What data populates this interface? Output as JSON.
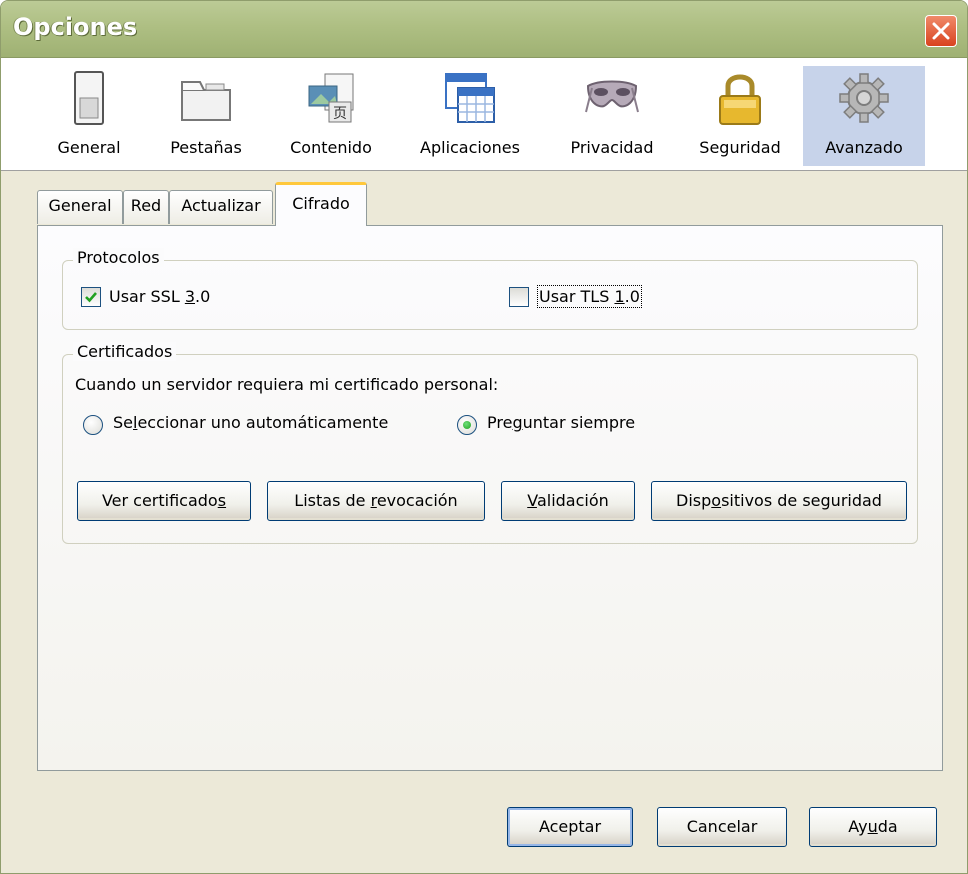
{
  "window": {
    "title": "Opciones"
  },
  "categories": [
    {
      "label": "General"
    },
    {
      "label": "Pestañas"
    },
    {
      "label": "Contenido"
    },
    {
      "label": "Aplicaciones"
    },
    {
      "label": "Privacidad"
    },
    {
      "label": "Seguridad"
    },
    {
      "label": "Avanzado",
      "selected": true
    }
  ],
  "tabs": [
    {
      "label": "General"
    },
    {
      "label": "Red"
    },
    {
      "label": "Actualizar"
    },
    {
      "label": "Cifrado",
      "active": true
    }
  ],
  "protocols": {
    "legend": "Protocolos",
    "ssl": {
      "label_pre": "Usar SSL ",
      "label_key": "3",
      "label_post": ".0",
      "checked": true
    },
    "tls": {
      "label_pre": "Usar TLS ",
      "label_key": "1",
      "label_post": ".0",
      "checked": false
    }
  },
  "certificates": {
    "legend": "Certificados",
    "prompt": "Cuando un servidor requiera mi certificado personal:",
    "auto": {
      "pre": "Se",
      "key": "l",
      "post": "eccionar uno automáticamente",
      "selected": false
    },
    "ask": {
      "pre": "Pre",
      "key": "g",
      "post": "untar siempre",
      "selected": true
    },
    "buttons": {
      "view": {
        "pre": "Ver certificado",
        "key": "s",
        "post": ""
      },
      "revocation": {
        "pre": "Listas de ",
        "key": "r",
        "post": "evocación"
      },
      "validation": {
        "pre": "",
        "key": "V",
        "post": "alidación"
      },
      "devices": {
        "pre": "Disp",
        "key": "o",
        "post": "sitivos de seguridad"
      }
    }
  },
  "footer": {
    "accept": "Aceptar",
    "cancel": "Cancelar",
    "help": {
      "pre": "Ay",
      "key": "u",
      "post": "da"
    }
  },
  "colors": {
    "titlebar": "#aebf83",
    "window_bg": "#ece9d8",
    "selected_category": "#c7d3ea",
    "active_tab_accent": "#ffc83c",
    "close_button": "#d9431f"
  }
}
